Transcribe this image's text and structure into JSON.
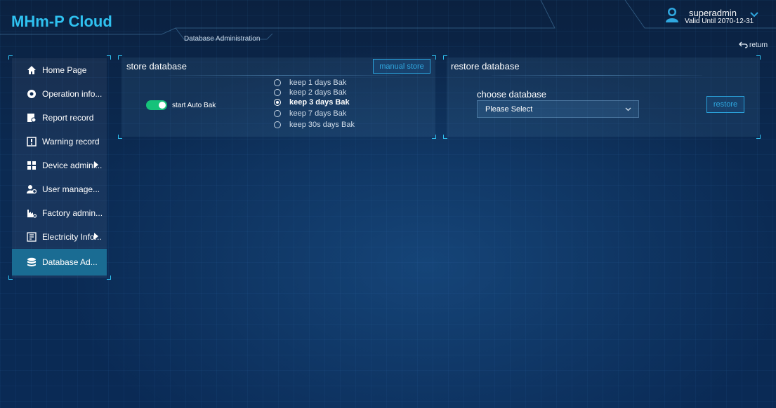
{
  "app": {
    "title": "MHm-P Cloud",
    "breadcrumb": "Database Administration"
  },
  "user": {
    "name": "superadmin",
    "valid_until": "Valid Until 2070-12-31"
  },
  "header": {
    "return_label": "return"
  },
  "sidebar": {
    "items": [
      {
        "label": "Home Page",
        "icon": "home-icon",
        "active": false,
        "has_submenu": false
      },
      {
        "label": "Operation info...",
        "icon": "operation-icon",
        "active": false,
        "has_submenu": false
      },
      {
        "label": "Report record",
        "icon": "report-icon",
        "active": false,
        "has_submenu": false
      },
      {
        "label": "Warning record",
        "icon": "warning-icon",
        "active": false,
        "has_submenu": false
      },
      {
        "label": "Device admini...",
        "icon": "device-icon",
        "active": false,
        "has_submenu": true
      },
      {
        "label": "User manage...",
        "icon": "user-icon",
        "active": false,
        "has_submenu": false
      },
      {
        "label": "Factory admin...",
        "icon": "factory-icon",
        "active": false,
        "has_submenu": false
      },
      {
        "label": "Electricity Info...",
        "icon": "electricity-icon",
        "active": false,
        "has_submenu": true
      },
      {
        "label": "Database Ad...",
        "icon": "database-icon",
        "active": true,
        "has_submenu": false
      }
    ]
  },
  "store": {
    "title": "store database",
    "manual_button": "manual store",
    "auto_bak_label": "start Auto Bak",
    "auto_bak_on": true,
    "options": [
      {
        "label": "keep 1 days Bak",
        "selected": false
      },
      {
        "label": "keep 2 days Bak",
        "selected": false
      },
      {
        "label": "keep 3 days Bak",
        "selected": true
      },
      {
        "label": "keep 7 days Bak",
        "selected": false
      },
      {
        "label": "keep 30s days Bak",
        "selected": false
      }
    ]
  },
  "restore": {
    "title": "restore database",
    "choose_label": "choose database",
    "select_placeholder": "Please Select",
    "restore_button": "restore"
  },
  "colors": {
    "accent": "#2fc1f0",
    "toggle_on": "#16c27a",
    "active_nav": "#1a6c93"
  }
}
